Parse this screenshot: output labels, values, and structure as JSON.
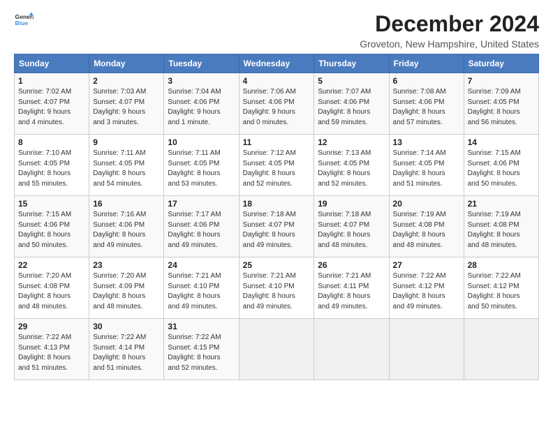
{
  "logo": {
    "line1": "General",
    "line2": "Blue"
  },
  "title": "December 2024",
  "subtitle": "Groveton, New Hampshire, United States",
  "days_header": [
    "Sunday",
    "Monday",
    "Tuesday",
    "Wednesday",
    "Thursday",
    "Friday",
    "Saturday"
  ],
  "weeks": [
    [
      {
        "day": "1",
        "info": "Sunrise: 7:02 AM\nSunset: 4:07 PM\nDaylight: 9 hours\nand 4 minutes."
      },
      {
        "day": "2",
        "info": "Sunrise: 7:03 AM\nSunset: 4:07 PM\nDaylight: 9 hours\nand 3 minutes."
      },
      {
        "day": "3",
        "info": "Sunrise: 7:04 AM\nSunset: 4:06 PM\nDaylight: 9 hours\nand 1 minute."
      },
      {
        "day": "4",
        "info": "Sunrise: 7:06 AM\nSunset: 4:06 PM\nDaylight: 9 hours\nand 0 minutes."
      },
      {
        "day": "5",
        "info": "Sunrise: 7:07 AM\nSunset: 4:06 PM\nDaylight: 8 hours\nand 59 minutes."
      },
      {
        "day": "6",
        "info": "Sunrise: 7:08 AM\nSunset: 4:06 PM\nDaylight: 8 hours\nand 57 minutes."
      },
      {
        "day": "7",
        "info": "Sunrise: 7:09 AM\nSunset: 4:05 PM\nDaylight: 8 hours\nand 56 minutes."
      }
    ],
    [
      {
        "day": "8",
        "info": "Sunrise: 7:10 AM\nSunset: 4:05 PM\nDaylight: 8 hours\nand 55 minutes."
      },
      {
        "day": "9",
        "info": "Sunrise: 7:11 AM\nSunset: 4:05 PM\nDaylight: 8 hours\nand 54 minutes."
      },
      {
        "day": "10",
        "info": "Sunrise: 7:11 AM\nSunset: 4:05 PM\nDaylight: 8 hours\nand 53 minutes."
      },
      {
        "day": "11",
        "info": "Sunrise: 7:12 AM\nSunset: 4:05 PM\nDaylight: 8 hours\nand 52 minutes."
      },
      {
        "day": "12",
        "info": "Sunrise: 7:13 AM\nSunset: 4:05 PM\nDaylight: 8 hours\nand 52 minutes."
      },
      {
        "day": "13",
        "info": "Sunrise: 7:14 AM\nSunset: 4:05 PM\nDaylight: 8 hours\nand 51 minutes."
      },
      {
        "day": "14",
        "info": "Sunrise: 7:15 AM\nSunset: 4:06 PM\nDaylight: 8 hours\nand 50 minutes."
      }
    ],
    [
      {
        "day": "15",
        "info": "Sunrise: 7:15 AM\nSunset: 4:06 PM\nDaylight: 8 hours\nand 50 minutes."
      },
      {
        "day": "16",
        "info": "Sunrise: 7:16 AM\nSunset: 4:06 PM\nDaylight: 8 hours\nand 49 minutes."
      },
      {
        "day": "17",
        "info": "Sunrise: 7:17 AM\nSunset: 4:06 PM\nDaylight: 8 hours\nand 49 minutes."
      },
      {
        "day": "18",
        "info": "Sunrise: 7:18 AM\nSunset: 4:07 PM\nDaylight: 8 hours\nand 49 minutes."
      },
      {
        "day": "19",
        "info": "Sunrise: 7:18 AM\nSunset: 4:07 PM\nDaylight: 8 hours\nand 48 minutes."
      },
      {
        "day": "20",
        "info": "Sunrise: 7:19 AM\nSunset: 4:08 PM\nDaylight: 8 hours\nand 48 minutes."
      },
      {
        "day": "21",
        "info": "Sunrise: 7:19 AM\nSunset: 4:08 PM\nDaylight: 8 hours\nand 48 minutes."
      }
    ],
    [
      {
        "day": "22",
        "info": "Sunrise: 7:20 AM\nSunset: 4:08 PM\nDaylight: 8 hours\nand 48 minutes."
      },
      {
        "day": "23",
        "info": "Sunrise: 7:20 AM\nSunset: 4:09 PM\nDaylight: 8 hours\nand 48 minutes."
      },
      {
        "day": "24",
        "info": "Sunrise: 7:21 AM\nSunset: 4:10 PM\nDaylight: 8 hours\nand 49 minutes."
      },
      {
        "day": "25",
        "info": "Sunrise: 7:21 AM\nSunset: 4:10 PM\nDaylight: 8 hours\nand 49 minutes."
      },
      {
        "day": "26",
        "info": "Sunrise: 7:21 AM\nSunset: 4:11 PM\nDaylight: 8 hours\nand 49 minutes."
      },
      {
        "day": "27",
        "info": "Sunrise: 7:22 AM\nSunset: 4:12 PM\nDaylight: 8 hours\nand 49 minutes."
      },
      {
        "day": "28",
        "info": "Sunrise: 7:22 AM\nSunset: 4:12 PM\nDaylight: 8 hours\nand 50 minutes."
      }
    ],
    [
      {
        "day": "29",
        "info": "Sunrise: 7:22 AM\nSunset: 4:13 PM\nDaylight: 8 hours\nand 51 minutes."
      },
      {
        "day": "30",
        "info": "Sunrise: 7:22 AM\nSunset: 4:14 PM\nDaylight: 8 hours\nand 51 minutes."
      },
      {
        "day": "31",
        "info": "Sunrise: 7:22 AM\nSunset: 4:15 PM\nDaylight: 8 hours\nand 52 minutes."
      },
      {
        "day": "",
        "info": ""
      },
      {
        "day": "",
        "info": ""
      },
      {
        "day": "",
        "info": ""
      },
      {
        "day": "",
        "info": ""
      }
    ]
  ]
}
